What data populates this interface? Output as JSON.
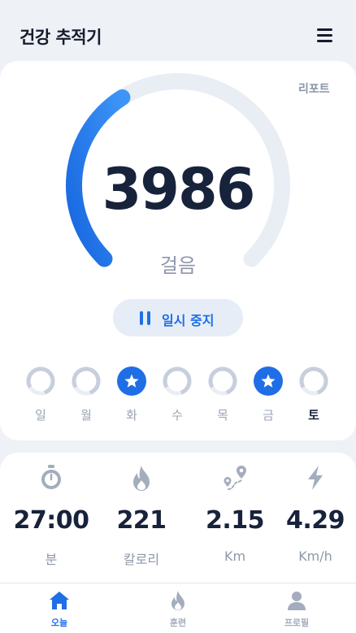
{
  "header": {
    "title": "건강 추적기",
    "menu_icon": "hamburger-menu-icon"
  },
  "main": {
    "report_label": "리포트",
    "steps": "3986",
    "steps_label": "걸음",
    "steps_progress": 0.38,
    "pause_label": "일시 중지"
  },
  "week": [
    {
      "label": "일",
      "goal_met": false,
      "progress": 0.15
    },
    {
      "label": "월",
      "goal_met": false,
      "progress": 0.15
    },
    {
      "label": "화",
      "goal_met": true,
      "progress": 1.0
    },
    {
      "label": "수",
      "goal_met": false,
      "progress": 0.15
    },
    {
      "label": "목",
      "goal_met": false,
      "progress": 0.15
    },
    {
      "label": "금",
      "goal_met": true,
      "progress": 1.0
    },
    {
      "label": "토",
      "goal_met": false,
      "progress": 0.15,
      "today": true
    }
  ],
  "stats": [
    {
      "icon": "stopwatch-icon",
      "value": "27:00",
      "unit": "분"
    },
    {
      "icon": "flame-icon",
      "value": "221",
      "unit": "칼로리"
    },
    {
      "icon": "route-icon",
      "value": "2.15",
      "unit": "Km"
    },
    {
      "icon": "lightning-icon",
      "value": "4.29",
      "unit": "Km/h"
    }
  ],
  "nav": [
    {
      "label": "오늘",
      "icon": "home-icon",
      "active": true
    },
    {
      "label": "훈련",
      "icon": "flame-icon",
      "active": false
    },
    {
      "label": "프로필",
      "icon": "profile-icon",
      "active": false
    }
  ],
  "colors": {
    "accent": "#1f6ee6",
    "accent_light": "#3a8ff5",
    "track": "#e9edf4",
    "day_ring": "#c7cfdc",
    "icon_muted": "#a4adbd",
    "text_dark": "#17223b"
  }
}
